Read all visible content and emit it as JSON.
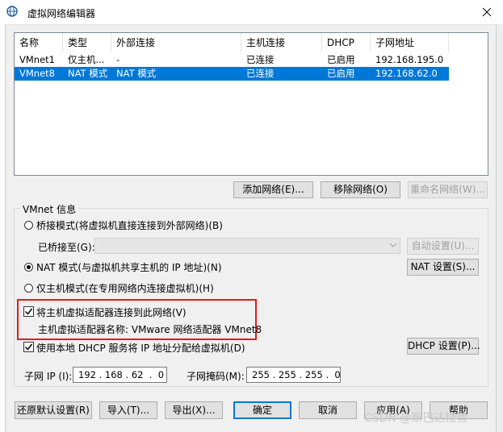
{
  "window": {
    "title": "虚拟网络编辑器"
  },
  "list": {
    "columns": [
      "名称",
      "类型",
      "外部连接",
      "主机连接",
      "DHCP",
      "子网地址"
    ],
    "rows": [
      [
        "VMnet1",
        "仅主机...",
        "-",
        "已连接",
        "已启用",
        "192.168.195.0"
      ],
      [
        "VMnet8",
        "NAT 模式",
        "NAT 模式",
        "已连接",
        "已启用",
        "192.168.62.0"
      ]
    ],
    "selected_row": 1
  },
  "list_buttons": {
    "add": "添加网络(E)...",
    "remove": "移除网络(O)",
    "rename": "重命名网络(W)..."
  },
  "vmnet_info": {
    "title": "VMnet 信息",
    "bridge_label": "桥接模式(将虚拟机直接连接到外部网络)(B)",
    "bridged_to_label": "已桥接至(G):",
    "bridged_to_value": "",
    "auto_settings": "自动设置(U)...",
    "nat_label": "NAT 模式(与虚拟机共享主机的 IP 地址)(N)",
    "nat_settings": "NAT 设置(S)...",
    "hostonly_label": "仅主机模式(在专用网络内连接虚拟机)(H)",
    "connect_adapter_label": "将主机虚拟适配器连接到此网络(V)",
    "adapter_name": "主机虚拟适配器名称: VMware 网络适配器 VMnet8",
    "dhcp_label": "使用本地 DHCP 服务将 IP 地址分配给虚拟机(D)",
    "dhcp_settings": "DHCP 设置(P)...",
    "subnet_ip_label": "子网 IP (I):",
    "subnet_ip": "192 . 168 . 62  .  0",
    "subnet_mask_label": "子网掩码(M):",
    "subnet_mask": "255 . 255 . 255 .  0"
  },
  "footer": {
    "restore": "还原默认设置(R)",
    "import": "导入(T)...",
    "export": "导出(X)...",
    "ok": "确定",
    "cancel": "取消",
    "apply": "应用(A)",
    "help": "帮助"
  },
  "watermark": "CSDN @斯巴达怪兽",
  "colors": {
    "selection": "#0078d7",
    "highlight_box": "#e31b1b"
  }
}
